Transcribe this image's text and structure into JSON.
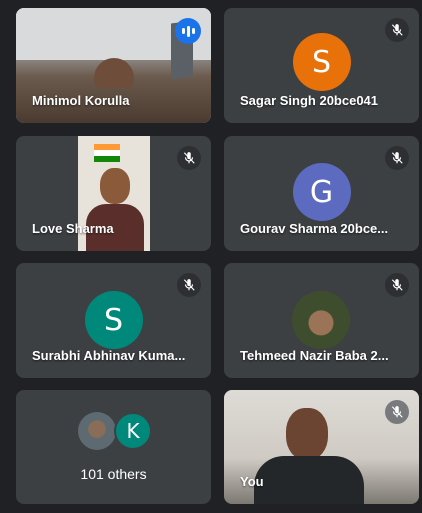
{
  "tiles": [
    {
      "name": "Minimol Korulla",
      "kind": "video",
      "speaking": true
    },
    {
      "name": "Sagar Singh 20bce041",
      "kind": "avatar",
      "initial": "S",
      "color": "#e8710a",
      "muted": true
    },
    {
      "name": "Love Sharma",
      "kind": "video",
      "muted": true
    },
    {
      "name": "Gourav Sharma 20bce...",
      "kind": "avatar",
      "initial": "G",
      "color": "#5c6bc0",
      "muted": true
    },
    {
      "name": "Surabhi Abhinav Kuma...",
      "kind": "avatar",
      "initial": "S",
      "color": "#00897b",
      "muted": true
    },
    {
      "name": "Tehmeed Nazir Baba 2...",
      "kind": "photo",
      "muted": true
    },
    {
      "name": "101 others",
      "kind": "group",
      "group_initial": "K"
    },
    {
      "name": "You",
      "kind": "video",
      "muted": true
    }
  ],
  "colors": {
    "background": "#202124",
    "tile": "#3c4043",
    "speaking_outline": "#8ab4f8",
    "speaking_badge": "#1a73e8"
  }
}
